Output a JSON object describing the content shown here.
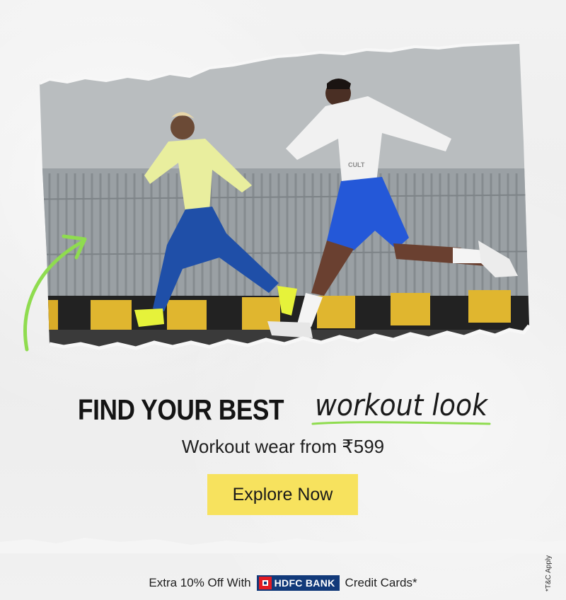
{
  "banner": {
    "headline_bold": "FIND YOUR BEST",
    "headline_script": "workout look",
    "subheading": "Workout wear from ₹599",
    "cta_label": "Explore Now",
    "offer_prefix": "Extra 10% Off With",
    "bank_name": "HDFC BANK",
    "offer_suffix": "Credit Cards*",
    "terms": "*T&C Apply",
    "photo_badge": "CULT"
  },
  "colors": {
    "cta_background": "#f7e25e",
    "accent_green": "#8fdc4f",
    "bank_blue": "#123a7a",
    "bank_red": "#e21b23"
  }
}
